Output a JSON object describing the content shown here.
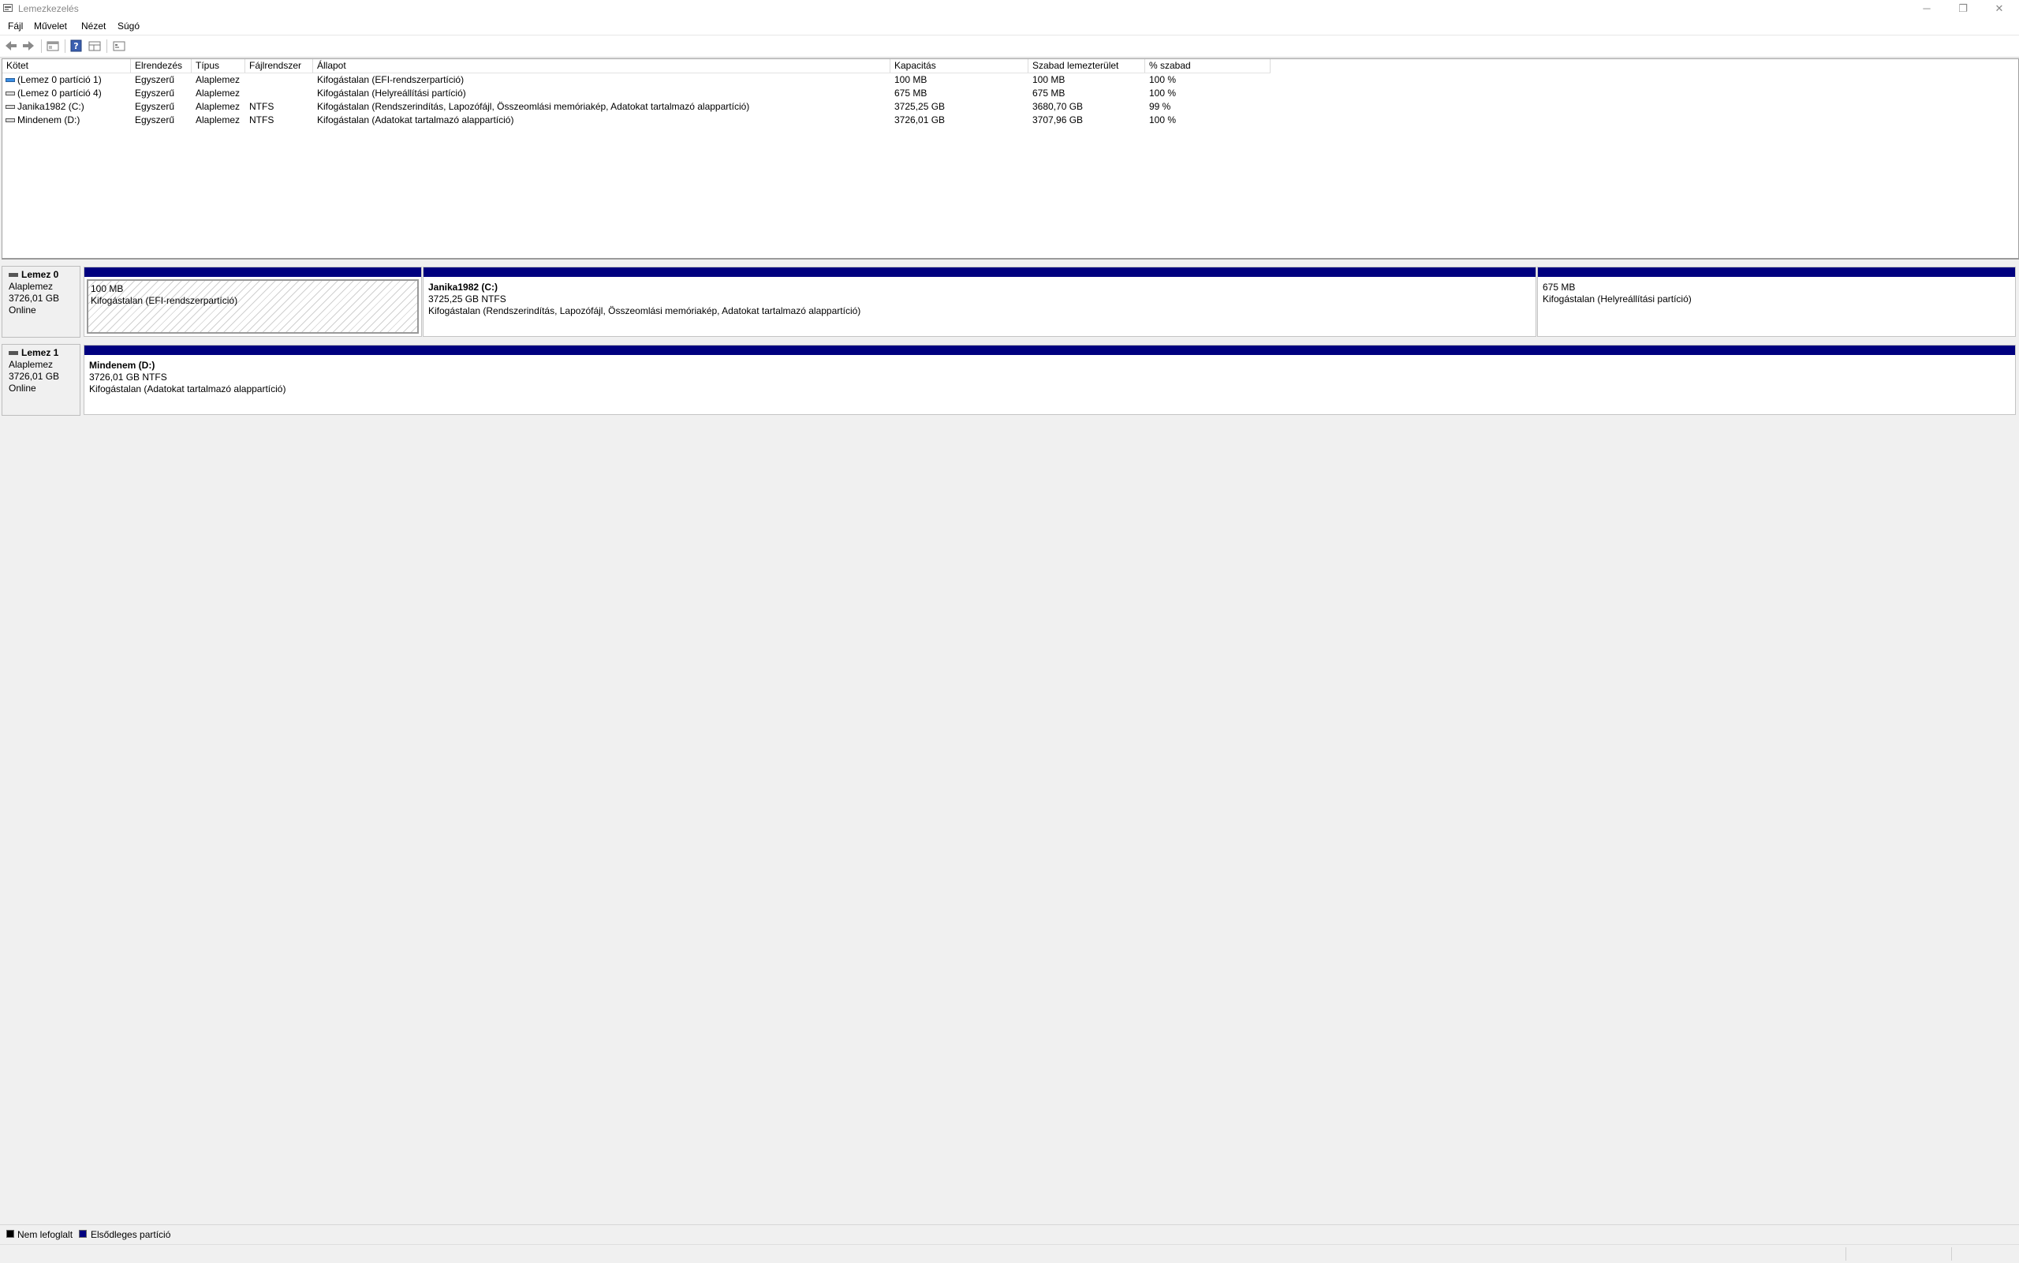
{
  "window": {
    "title": "Lemezkezelés",
    "minimize": "─",
    "maximize": "❐",
    "close": "✕"
  },
  "menu": [
    "Fájl",
    "Művelet",
    "Nézet",
    "Súgó"
  ],
  "toolbar": {
    "icons": [
      "back-arrow-icon",
      "forward-arrow-icon",
      "properties-icon",
      "help-icon",
      "view-toggle-icon",
      "console-tree-icon"
    ]
  },
  "volume_list": {
    "columns": [
      "Kötet",
      "Elrendezés",
      "Típus",
      "Fájlrendszer",
      "Állapot",
      "Kapacitás",
      "Szabad lemezterület",
      "% szabad"
    ],
    "rows": [
      [
        "(Lemez 0 partíció 1)",
        "Egyszerű",
        "Alaplemez",
        "",
        "Kifogástalan (EFI-rendszerpartíció)",
        "100 MB",
        "100 MB",
        "100 %"
      ],
      [
        "(Lemez 0 partíció 4)",
        "Egyszerű",
        "Alaplemez",
        "",
        "Kifogástalan (Helyreállítási partíció)",
        "675 MB",
        "675 MB",
        "100 %"
      ],
      [
        "Janika1982 (C:)",
        "Egyszerű",
        "Alaplemez",
        "NTFS",
        "Kifogástalan (Rendszerindítás, Lapozófájl, Összeomlási memóriakép, Adatokat tartalmazó alappartíció)",
        "3725,25 GB",
        "3680,70 GB",
        "99 %"
      ],
      [
        "Mindenem (D:)",
        "Egyszerű",
        "Alaplemez",
        "NTFS",
        "Kifogástalan (Adatokat tartalmazó alappartíció)",
        "3726,01 GB",
        "3707,96 GB",
        "100 %"
      ]
    ]
  },
  "disks": [
    {
      "name": "Lemez 0",
      "type": "Alaplemez",
      "size": "3726,01 GB",
      "status": "Online",
      "partitions": [
        {
          "title": "",
          "line1": "100 MB",
          "line2": "Kifogástalan (EFI-rendszerpartíció)",
          "selected": true
        },
        {
          "title": "Janika1982  (C:)",
          "line1": "3725,25 GB NTFS",
          "line2": "Kifogástalan (Rendszerindítás, Lapozófájl, Összeomlási memóriakép, Adatokat tartalmazó alappartíció)",
          "selected": false
        },
        {
          "title": "",
          "line1": "675 MB",
          "line2": "Kifogástalan (Helyreállítási partíció)",
          "selected": false
        }
      ]
    },
    {
      "name": "Lemez 1",
      "type": "Alaplemez",
      "size": "3726,01 GB",
      "status": "Online",
      "partitions": [
        {
          "title": "Mindenem  (D:)",
          "line1": "3726,01 GB NTFS",
          "line2": "Kifogástalan (Adatokat tartalmazó alappartíció)",
          "selected": false
        }
      ]
    }
  ],
  "legend": [
    {
      "label": "Nem lefoglalt",
      "color": "#000000"
    },
    {
      "label": "Elsődleges partíció",
      "color": "#00007f"
    }
  ]
}
